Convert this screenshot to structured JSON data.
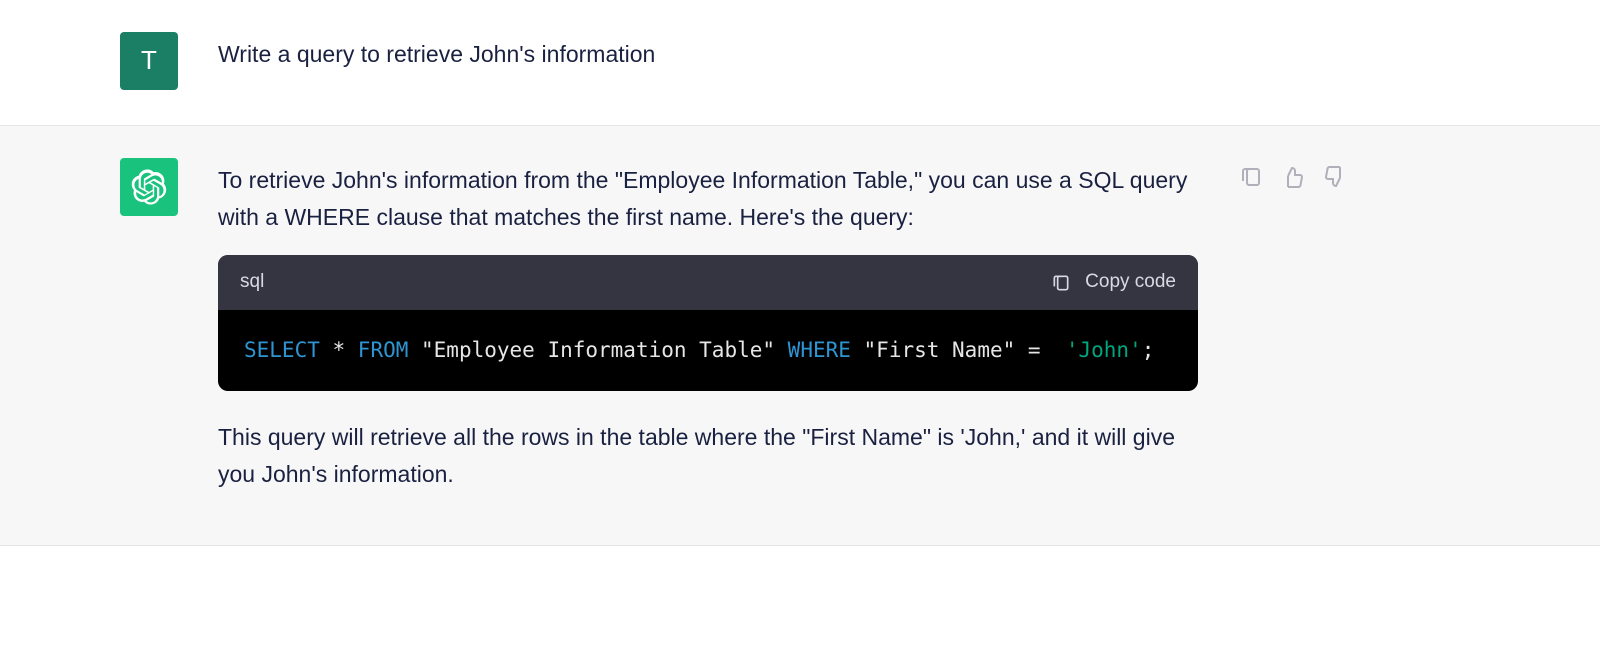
{
  "user": {
    "avatar_letter": "T",
    "message": "Write a query to retrieve John's information"
  },
  "assistant": {
    "intro": "To retrieve John's information from the \"Employee Information Table,\" you can use a SQL query with a WHERE clause that matches the first name. Here's the query:",
    "code": {
      "language": "sql",
      "copy_label": "Copy code",
      "tokens": {
        "kw_select": "SELECT",
        "star": " * ",
        "kw_from": "FROM",
        "table": " \"Employee Information Table\" ",
        "kw_where": "WHERE",
        "col": " \"First Name\" ",
        "eq": "=",
        "space": "  ",
        "val": "'John'",
        "semi": ";"
      }
    },
    "outro": "This query will retrieve all the rows in the table where the \"First Name\" is 'John,' and it will give you John's information."
  }
}
